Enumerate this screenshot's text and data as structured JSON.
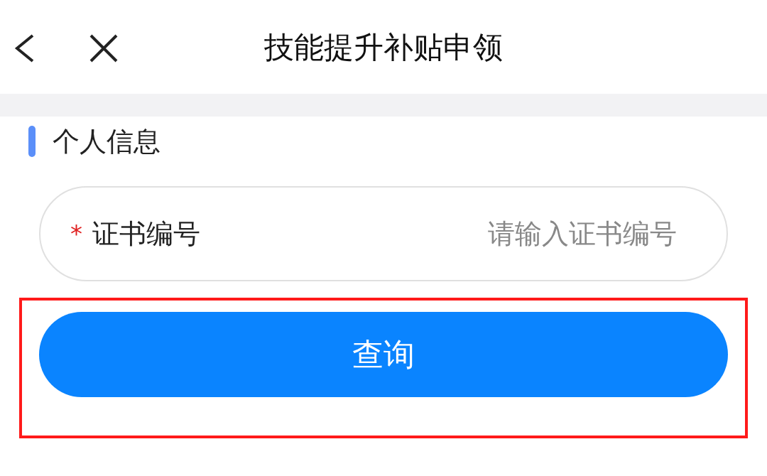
{
  "header": {
    "title": "技能提升补贴申领"
  },
  "section": {
    "title": "个人信息"
  },
  "field": {
    "label": "证书编号",
    "required_mark": "*",
    "placeholder": "请输入证书编号"
  },
  "button": {
    "label": "查询",
    "highlighted": true
  }
}
